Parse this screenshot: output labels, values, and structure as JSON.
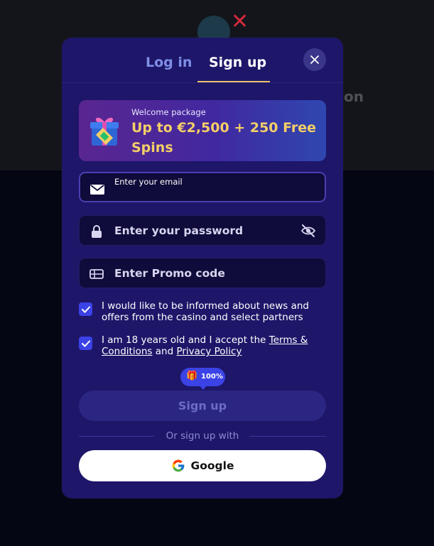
{
  "background": {
    "partial_text": "on"
  },
  "tabs": [
    {
      "label": "Log in",
      "active": false
    },
    {
      "label": "Sign up",
      "active": true
    }
  ],
  "promo": {
    "small": "Welcome package",
    "big": "Up to €2,500 + 250 Free Spins"
  },
  "form": {
    "email_label": "Enter your email",
    "password_placeholder": "Enter your password",
    "promo_placeholder": "Enter Promo code"
  },
  "checkboxes": {
    "news": {
      "checked": true,
      "text": "I would like to be informed about news and offers from the casino and select partners"
    },
    "age": {
      "checked": true,
      "text_before": "I am 18 years old and I accept the ",
      "terms_link": "Terms & Conditions",
      "and": " and ",
      "privacy_link": "Privacy Policy"
    }
  },
  "badge": {
    "text": "100%"
  },
  "signup_button": "Sign up",
  "or_text": "Or sign up with",
  "google_button": "Google",
  "colors": {
    "modal_bg": "#1e1669",
    "accent_gold": "#f4cf66",
    "accent_blue": "#3b43e6"
  }
}
